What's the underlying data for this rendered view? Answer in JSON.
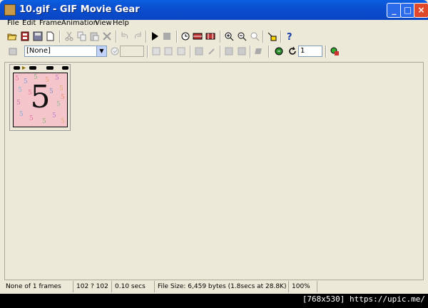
{
  "window": {
    "title": "10.gif - GIF Movie Gear"
  },
  "menu": [
    "File",
    "Edit",
    "Frame",
    "Animation",
    "View",
    "Help"
  ],
  "toolbar2": {
    "transparency_value": "[None]",
    "loop_count": "1"
  },
  "frame": {
    "digit": "5"
  },
  "status": {
    "frames": "None of 1 frames",
    "dimensions": "102 ? 102",
    "delay": "0.10 secs",
    "file_size": "File Size: 6,459 bytes  (1.8secs at 28.8K)",
    "zoom": "100%"
  },
  "watermark": "[768x530] https://upic.me/",
  "colors": {
    "titlebar": "#0b4fd0",
    "face": "#ece9d8",
    "close": "#e0482a"
  }
}
